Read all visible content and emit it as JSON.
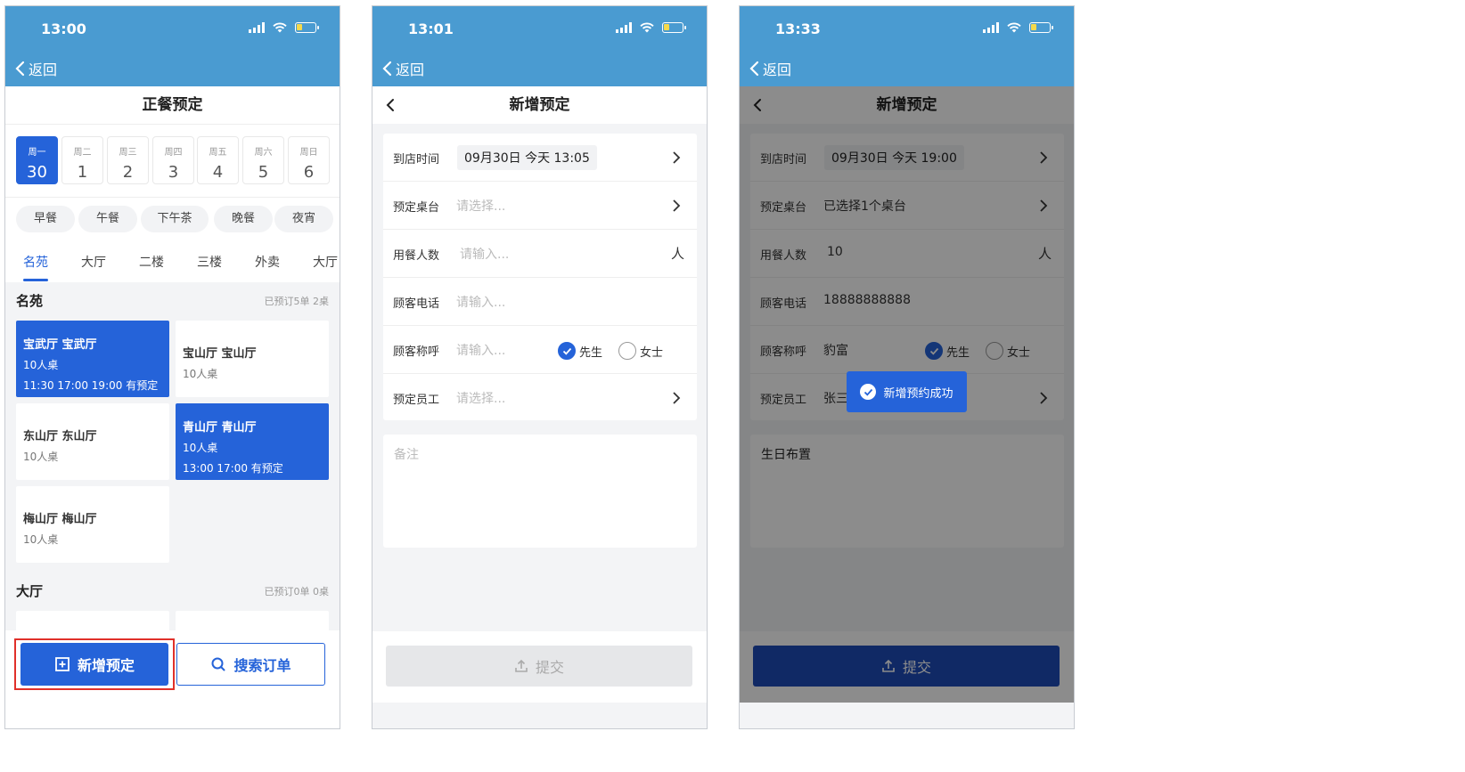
{
  "screens": [
    {
      "time": "13:00",
      "back_label": "返回",
      "title": "正餐预定",
      "week": [
        {
          "weekday": "周一",
          "date": "30",
          "active": true
        },
        {
          "weekday": "周二",
          "date": "1"
        },
        {
          "weekday": "周三",
          "date": "2"
        },
        {
          "weekday": "周四",
          "date": "3"
        },
        {
          "weekday": "周五",
          "date": "4"
        },
        {
          "weekday": "周六",
          "date": "5"
        },
        {
          "weekday": "周日",
          "date": "6"
        }
      ],
      "meals": [
        "早餐",
        "午餐",
        "下午茶",
        "晚餐",
        "夜宵"
      ],
      "area_tabs": [
        "名苑",
        "大厅",
        "二楼",
        "三楼",
        "外卖",
        "大厅"
      ],
      "sections": [
        {
          "name": "名苑",
          "summary": "已预订5单 2桌",
          "rooms": [
            {
              "name": "宝武厅 宝武厅",
              "size": "10人桌",
              "times": "11:30 17:00 19:00 有预定",
              "booked": true
            },
            {
              "name": "宝山厅 宝山厅",
              "size": "10人桌"
            },
            {
              "name": "东山厅 东山厅",
              "size": "10人桌"
            },
            {
              "name": "青山厅 青山厅",
              "size": "10人桌",
              "times": "13:00 17:00 有预定",
              "booked": true
            },
            {
              "name": "梅山厅 梅山厅",
              "size": "10人桌"
            }
          ]
        },
        {
          "name": "大厅",
          "summary": "已预订0单 0桌"
        }
      ],
      "buttons": {
        "add": "新增预定",
        "search": "搜索订单"
      }
    },
    {
      "time": "13:01",
      "back_label": "返回",
      "title": "新增预定",
      "fields": {
        "arrival": {
          "label": "到店时间",
          "value": "09月30日 今天 13:05"
        },
        "table": {
          "label": "预定桌台",
          "placeholder": "请选择..."
        },
        "guests": {
          "label": "用餐人数",
          "placeholder": "请输入...",
          "unit": "人"
        },
        "phone": {
          "label": "顾客电话",
          "placeholder": "请输入..."
        },
        "salutation": {
          "label": "顾客称呼",
          "placeholder": "请输入...",
          "options": [
            "先生",
            "女士"
          ],
          "selected": "先生"
        },
        "staff": {
          "label": "预定员工",
          "placeholder": "请选择..."
        }
      },
      "remark_placeholder": "备注",
      "submit_label": "提交"
    },
    {
      "time": "13:33",
      "back_label": "返回",
      "title": "新增预定",
      "fields": {
        "arrival": {
          "label": "到店时间",
          "value": "09月30日 今天 19:00"
        },
        "table": {
          "label": "预定桌台",
          "value": "已选择1个桌台"
        },
        "guests": {
          "label": "用餐人数",
          "value": "10",
          "unit": "人"
        },
        "phone": {
          "label": "顾客电话",
          "value": "18888888888"
        },
        "salutation": {
          "label": "顾客称呼",
          "value": "豹富",
          "options": [
            "先生",
            "女士"
          ],
          "selected": "先生"
        },
        "staff": {
          "label": "预定员工",
          "value": "张三"
        }
      },
      "remark": "生日布置",
      "submit_label": "提交",
      "toast": "新增预约成功"
    }
  ],
  "colors": {
    "statusbar": "#4a9bd1",
    "accent": "#2563d9",
    "highlight": "#e0302a"
  },
  "icons": {
    "back": "chevron-left-icon",
    "next": "chevron-right-icon",
    "add": "plus-square-icon",
    "search": "search-icon",
    "submit": "upload-icon",
    "check": "check-icon"
  }
}
